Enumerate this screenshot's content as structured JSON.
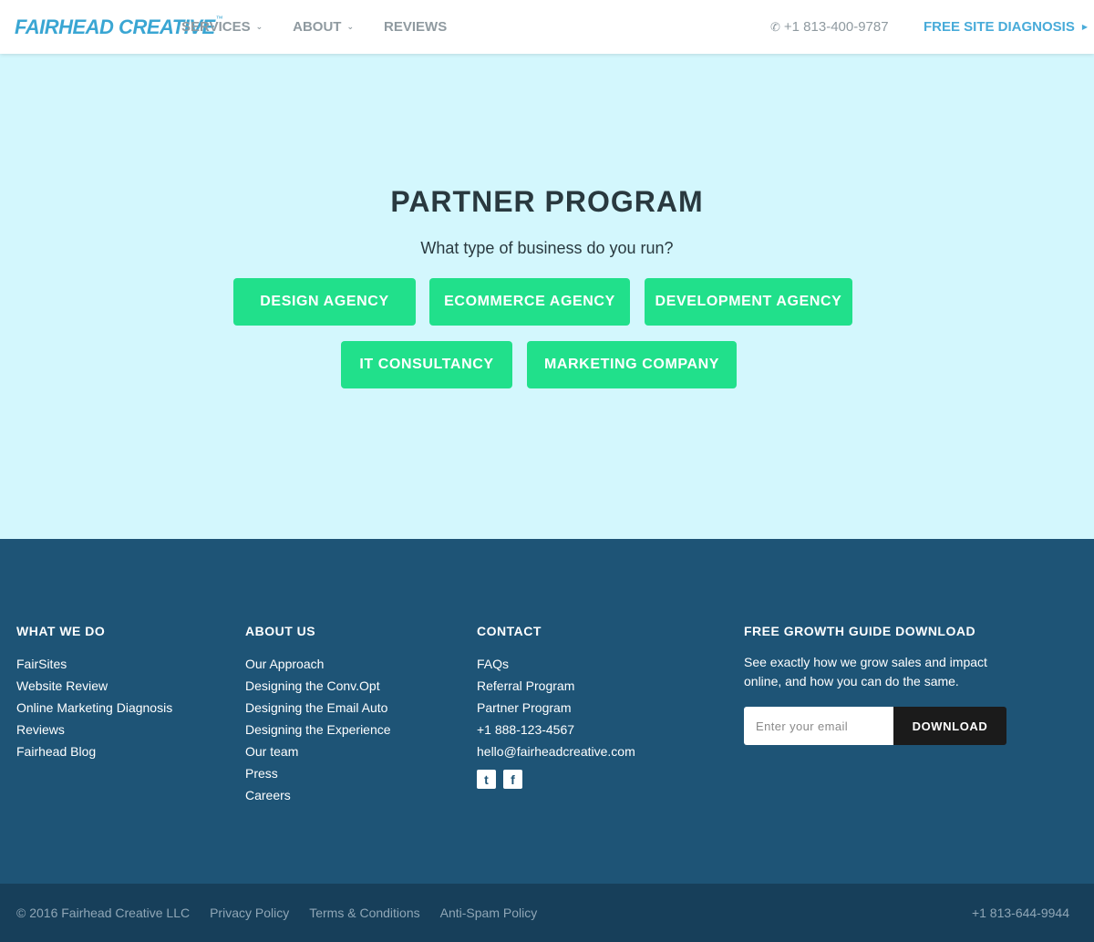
{
  "header": {
    "logo": {
      "text": "FAIRHEAD CREATIVE",
      "tm": "™"
    },
    "nav": [
      {
        "label": "SERVICES",
        "has_dropdown": true
      },
      {
        "label": "ABOUT",
        "has_dropdown": true
      },
      {
        "label": "REVIEWS",
        "has_dropdown": false
      }
    ],
    "phone": "+1 813-400-9787",
    "cta": "FREE SITE DIAGNOSIS"
  },
  "hero": {
    "title": "PARTNER PROGRAM",
    "subtitle": "What type of business do you run?",
    "buttons": [
      "DESIGN AGENCY",
      "ECOMMERCE AGENCY",
      "DEVELOPMENT AGENCY",
      "IT CONSULTANCY",
      "MARKETING COMPANY"
    ]
  },
  "footer": {
    "what_we_do": {
      "heading": "WHAT WE DO",
      "links": [
        "FairSites",
        "Website Review",
        "Online Marketing Diagnosis",
        "Reviews",
        "Fairhead Blog"
      ]
    },
    "about_us": {
      "heading": "ABOUT US",
      "links": [
        "Our Approach",
        "Designing the Conv.Opt",
        "Designing the Email Auto",
        "Designing the Experience",
        "Our team",
        "Press",
        "Careers"
      ]
    },
    "contact": {
      "heading": "CONTACT",
      "links": [
        "FAQs",
        "Referral Program",
        "Partner Program",
        "+1 888-123-4567",
        "hello@fairheadcreative.com"
      ],
      "social": [
        {
          "icon": "twitter-icon",
          "glyph": "t"
        },
        {
          "icon": "facebook-icon",
          "glyph": "f"
        }
      ]
    },
    "growth_guide": {
      "heading": "FREE GROWTH GUIDE DOWNLOAD",
      "text": "See exactly how we grow sales and impact online, and how you can do the same.",
      "email_placeholder": "Enter your email",
      "button": "DOWNLOAD"
    }
  },
  "bottom": {
    "copyright": "© 2016 Fairhead Creative LLC",
    "links": [
      "Privacy Policy",
      "Terms & Conditions",
      "Anti-Spam Policy"
    ],
    "phone": "+1 813-644-9944"
  },
  "colors": {
    "brand_blue": "#3aa6d3",
    "hero_bg": "#d3f7fd",
    "button_green": "#21e08b",
    "footer_bg": "#1e5476",
    "bottom_bg": "#173f5a"
  }
}
